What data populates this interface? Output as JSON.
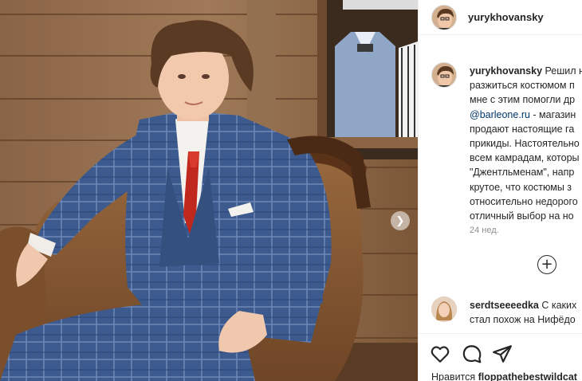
{
  "post_header": {
    "username": "yurykhovansky"
  },
  "caption": {
    "username": "yurykhovansky",
    "lines": [
      "Решил н",
      "разжиться костюмом п",
      "мне с этим помогли др",
      "",
      "продают настоящие га",
      "прикиды. Настоятельно",
      "всем камрадам, которы",
      "\"Джентльменам\", напр",
      "крутое, что костюмы з",
      "относительно недорого",
      "отличный выбор на но"
    ],
    "mention": "@barleone.ru",
    "mention_suffix": " - магазин",
    "time_ago": "24 нед."
  },
  "comment": {
    "username": "serdtseeeedka",
    "text": " С каких",
    "line2": "стал похож на Нифёдо"
  },
  "likes": {
    "prefix": "Нравится ",
    "username": "floppathebestwildcat"
  },
  "icons": {
    "like": "heart-icon",
    "comment": "comment-bubble-icon",
    "share": "paper-plane-icon",
    "load_more": "plus-circle-icon",
    "carousel_next": "chevron-right-icon"
  },
  "carousel": {
    "next_glyph": "❯"
  },
  "load_more": {
    "glyph": "+"
  }
}
